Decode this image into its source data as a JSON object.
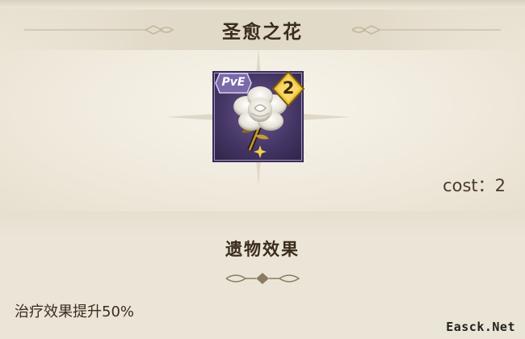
{
  "relic": {
    "title": "圣愈之花",
    "mode_badge": "PvE",
    "level": "2",
    "cost_text": "cost：2",
    "icon": "white-flower-relic-icon"
  },
  "effect_section": {
    "title": "遗物效果",
    "description": "治疗效果提升50%"
  },
  "watermark": "Easck.Net",
  "colors": {
    "background": "#efe9da",
    "icon_frame": "#463767",
    "badge_gold": "#e8b830",
    "badge_purple": "#7a6aa8"
  }
}
